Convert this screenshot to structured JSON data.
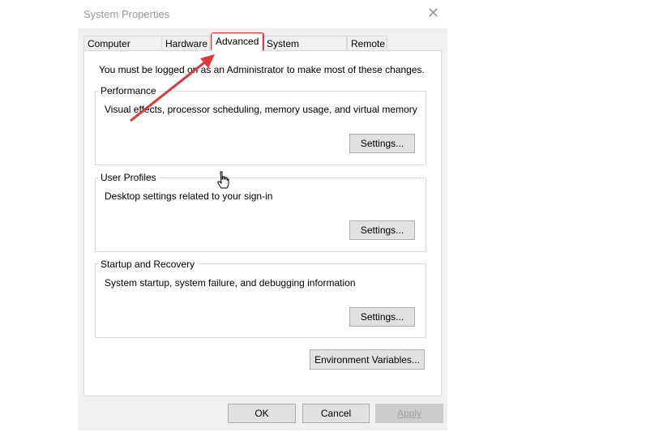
{
  "window": {
    "title": "System Properties"
  },
  "tabs": [
    {
      "label": "Computer Name"
    },
    {
      "label": "Hardware"
    },
    {
      "label": "Advanced"
    },
    {
      "label": "System Protection"
    },
    {
      "label": "Remote"
    }
  ],
  "active_tab": "Advanced",
  "notice": "You must be logged on as an Administrator to make most of these changes.",
  "groups": {
    "performance": {
      "label": "Performance",
      "desc": "Visual effects, processor scheduling, memory usage, and virtual memory",
      "button": "Settings..."
    },
    "profiles": {
      "label": "User Profiles",
      "desc": "Desktop settings related to your sign-in",
      "button": "Settings..."
    },
    "startup": {
      "label": "Startup and Recovery",
      "desc": "System startup, system failure, and debugging information",
      "button": "Settings..."
    }
  },
  "env_button": "Environment Variables...",
  "footer": {
    "ok": "OK",
    "cancel": "Cancel",
    "apply": "Apply"
  },
  "colors": {
    "annotation": "#e0373a"
  }
}
